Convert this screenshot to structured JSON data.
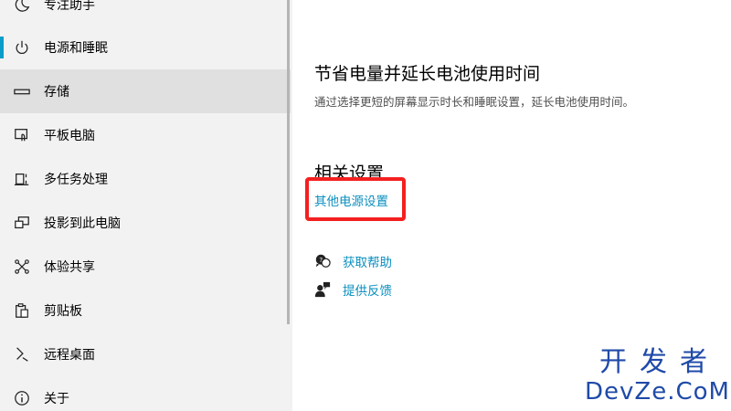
{
  "sidebar": {
    "items": [
      {
        "label": "专注助手",
        "icon": "moon-icon"
      },
      {
        "label": "电源和睡眠",
        "icon": "power-icon"
      },
      {
        "label": "存储",
        "icon": "storage-drive-icon"
      },
      {
        "label": "平板电脑",
        "icon": "tablet-icon"
      },
      {
        "label": "多任务处理",
        "icon": "multitasking-icon"
      },
      {
        "label": "投影到此电脑",
        "icon": "project-to-pc-icon"
      },
      {
        "label": "体验共享",
        "icon": "shared-experiences-icon"
      },
      {
        "label": "剪贴板",
        "icon": "clipboard-icon"
      },
      {
        "label": "远程桌面",
        "icon": "remote-desktop-icon"
      },
      {
        "label": "关于",
        "icon": "info-icon"
      }
    ],
    "selected_item": "存储",
    "accent_item": "电源和睡眠"
  },
  "main": {
    "battery_title": "节省电量并延长电池使用时间",
    "battery_desc": "通过选择更短的屏幕显示时长和睡眠设置，延长电池使用时间。",
    "related_title": "相关设置",
    "related_link": "其他电源设置",
    "get_help": "获取帮助",
    "give_feedback": "提供反馈"
  },
  "watermark": {
    "line1": "开发者",
    "line2": "DevZe.CoM"
  },
  "colors": {
    "accent": "#0a9dc9",
    "link": "#0a8fbf",
    "highlight": "#f42020",
    "sidebar_bg": "#f2f2f2",
    "selected_bg": "#e0e0e0"
  }
}
